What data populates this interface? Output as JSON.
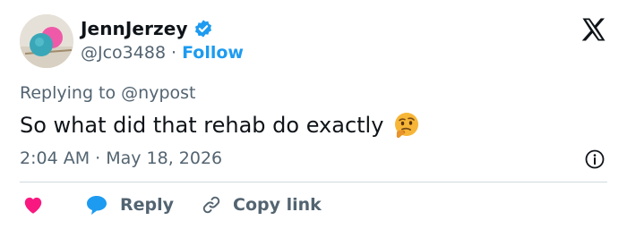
{
  "author": {
    "display_name": "JennJerzey",
    "handle": "@Jco3488",
    "separator": "·",
    "follow_label": "Follow",
    "verified": true,
    "verified_color": "#1d9bf0"
  },
  "reply_context": "Replying to @nypost",
  "tweet": {
    "text": "So what did that rehab do exactly",
    "emoji": "thinking-face-icon"
  },
  "timestamp": "2:04 AM · May 18, 2026",
  "actions": {
    "like_icon": "heart-icon",
    "like_color": "#f91880",
    "reply_label": "Reply",
    "reply_icon_color": "#1d9bf0",
    "copy_label": "Copy link"
  },
  "colors": {
    "text": "#0f1419",
    "secondary": "#536471",
    "accent": "#1d9bf0",
    "divider": "#cfd9de"
  }
}
